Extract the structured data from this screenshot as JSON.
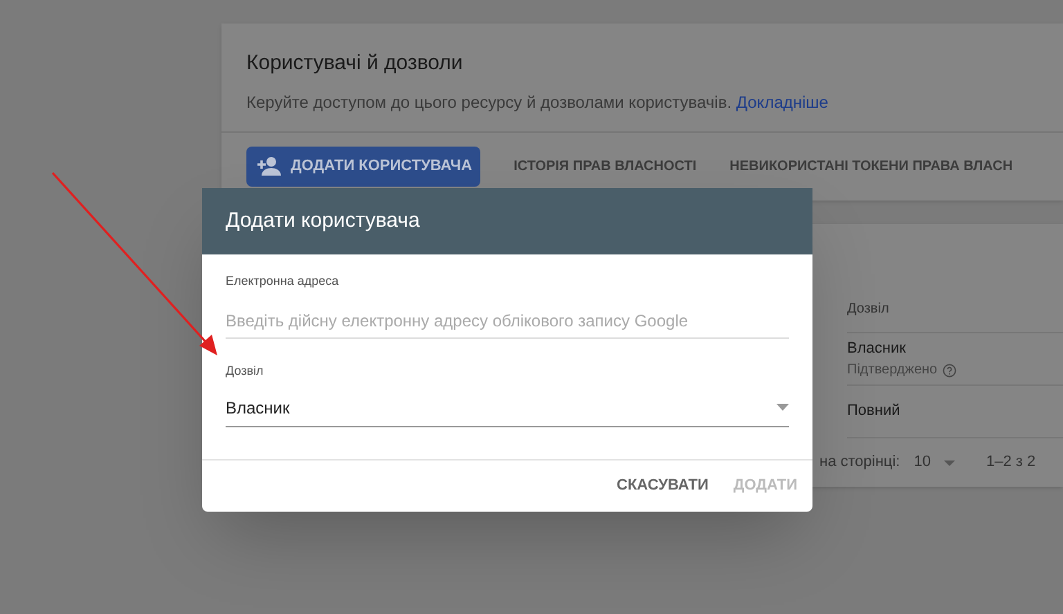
{
  "page": {
    "title": "Користувачі й дозволи",
    "description": "Керуйте доступом до цього ресурсу й дозволами користувачів.",
    "link": "Докладніше",
    "add_button": "ДОДАТИ КОРИСТУВАЧА",
    "tabs": [
      "ІСТОРІЯ ПРАВ ВЛАСНОСТІ",
      "НЕВИКОРИСТАНІ ТОКЕНИ ПРАВА ВЛАСН"
    ]
  },
  "table": {
    "columns": [
      "Дозвіл"
    ],
    "rows": [
      {
        "permission": "Власник",
        "status": "Підтверджено"
      },
      {
        "permission": "Повний"
      }
    ]
  },
  "pagination": {
    "rows_label": "на сторінці:",
    "page_size": "10",
    "range": "1–2 з 2"
  },
  "dialog": {
    "title": "Додати користувача",
    "email": {
      "label": "Електронна адреса",
      "placeholder": "Введіть дійсну електронну адресу облікового запису Google"
    },
    "permission": {
      "label": "Дозвіл",
      "value": "Власник"
    },
    "buttons": [
      {
        "label": "СКАСУВАТИ",
        "disabled": false
      },
      {
        "label": "ДОДАТИ",
        "disabled": true
      }
    ]
  }
}
